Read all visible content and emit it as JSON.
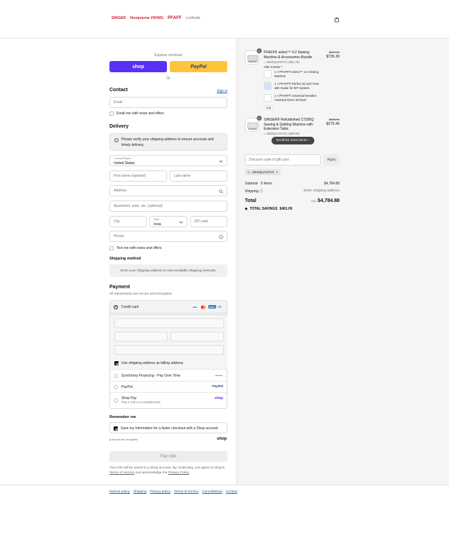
{
  "header": {
    "brands": [
      "SINGER",
      "Husqvarna VIKING",
      "PFAFF",
      "craftside"
    ]
  },
  "express": {
    "label": "Express checkout",
    "shop_label": "shop",
    "paypal_label": "PayPal",
    "or_label": "Or"
  },
  "contact": {
    "title": "Contact",
    "signin": "Sign in",
    "email_placeholder": "Email",
    "news_label": "Email me with news and offers"
  },
  "delivery": {
    "title": "Delivery",
    "notice": "Please verify your shipping address to ensure accurate and timely delivery.",
    "country_label": "Country/Region",
    "country_value": "United States",
    "first_name": "First name (optional)",
    "last_name": "Last name",
    "address": "Address",
    "apartment": "Apartment, suite, etc. (optional)",
    "city": "City",
    "state_label": "State",
    "state_value": "Iowa",
    "zip": "ZIP code",
    "phone": "Phone",
    "text_label": "Text me with news and offers"
  },
  "shipping": {
    "title": "Shipping method",
    "message": "Enter your shipping address to view available shipping methods."
  },
  "payment": {
    "title": "Payment",
    "subtitle": "All transactions are secure and encrypted.",
    "credit_card": "Credit card",
    "more_cards": "+5",
    "billing_label": "Use shipping address as billing address",
    "synchrony": "Synchrony Financing - Pay Over Time",
    "paypal": "PayPal",
    "shoppay": "Shop Pay",
    "shoppay_sub": "Pay in full or in installments",
    "shoppay_logo": "shop",
    "paypal_logo": "PayPal"
  },
  "remember": {
    "title": "Remember me",
    "save_label": "Save my information for a faster checkout with a Shop account",
    "secure": "Secure and encrypted",
    "shop_logo": "shop"
  },
  "paynow": "Pay now",
  "legal": {
    "text1": "Your info will be saved to a Shop account. By continuing, you agree to Shop's ",
    "tos": "Terms of Service",
    "text2": " and acknowledge the ",
    "privacy": "Privacy Policy",
    "text3": "."
  },
  "footer": [
    "Refund policy",
    "Shipping",
    "Privacy policy",
    "Terms of service",
    "Cancellations",
    "Contact"
  ],
  "summary": {
    "items": [
      {
        "qty": "1",
        "name": "PFAFF® select™ 4.2 Sewing Machine & Accessories Bundle",
        "code": "SEWQUANT10 (-$81.75)",
        "hide": "Hide 3 items",
        "orig": "$817.00",
        "price": "$735.30"
      },
      {
        "qty": "1",
        "name": "SINGER® Refurbished C7290Q Sewing & Quilting Machine with Extension Table",
        "code": "SEWQUANT10 (-$30.59)",
        "orig": "$305.99",
        "price": "$275.40"
      }
    ],
    "sub_items": [
      "1 × PFAFF® select™ 4.2 Sewing Machine",
      "1 × PFAFF® Perfect 54 inch Foot with Guide for IDT System",
      "1 × PFAFF® Universal Needles Assorted Sizes 10-Pack"
    ],
    "edit": "Edit",
    "scroll_pill": "Scroll for more items",
    "discount_placeholder": "Discount code or gift card",
    "apply": "Apply",
    "code_chip": "SEWQUANT10",
    "subtotal_label": "Subtotal · 5 items",
    "subtotal_value": "$4,784.88",
    "shipping_label": "Shipping",
    "shipping_value": "Enter shipping address",
    "total_label": "Total",
    "currency": "USD",
    "total_value": "$4,784.88",
    "savings_label": "TOTAL SAVINGS",
    "savings_value": "$481.09"
  },
  "colors": {
    "shop_purple": "#5a31f4",
    "paypal_yellow": "#ffc439",
    "link_blue": "#1a5cae",
    "singer_red": "#c8102e"
  }
}
